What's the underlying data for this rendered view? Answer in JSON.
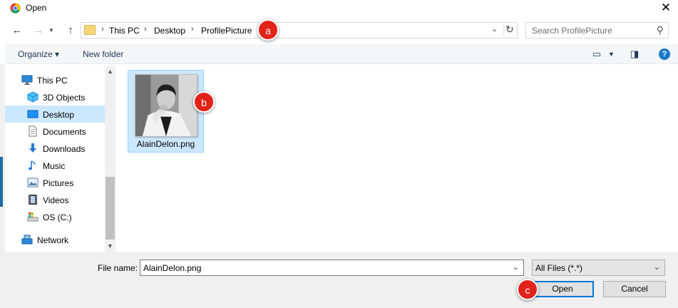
{
  "window": {
    "title": "Open"
  },
  "nav": {
    "breadcrumb": [
      "This PC",
      "Desktop",
      "ProfilePicture"
    ],
    "search_placeholder": "Search ProfilePicture"
  },
  "toolbar": {
    "organize": "Organize ▾",
    "new_folder": "New folder"
  },
  "sidebar": {
    "items": [
      {
        "label": "This PC",
        "icon": "pc-icon"
      },
      {
        "label": "3D Objects",
        "icon": "cube-icon"
      },
      {
        "label": "Desktop",
        "icon": "desktop-icon",
        "selected": true
      },
      {
        "label": "Documents",
        "icon": "document-icon"
      },
      {
        "label": "Downloads",
        "icon": "download-icon"
      },
      {
        "label": "Music",
        "icon": "music-icon"
      },
      {
        "label": "Pictures",
        "icon": "picture-icon"
      },
      {
        "label": "Videos",
        "icon": "video-icon"
      },
      {
        "label": "OS (C:)",
        "icon": "drive-icon"
      },
      {
        "label": "Network",
        "icon": "network-icon"
      }
    ]
  },
  "files": [
    {
      "name": "AlainDelon.png",
      "selected": true
    }
  ],
  "bottom": {
    "file_name_label": "File name:",
    "file_name_value": "AlainDelon.png",
    "filter_value": "All Files (*.*)",
    "open_label": "Open",
    "cancel_label": "Cancel"
  },
  "callouts": {
    "a": "a",
    "b": "b",
    "c": "c"
  },
  "colors": {
    "accent": "#0078d7",
    "selection": "#cce8ff",
    "callout": "#e2231a"
  }
}
